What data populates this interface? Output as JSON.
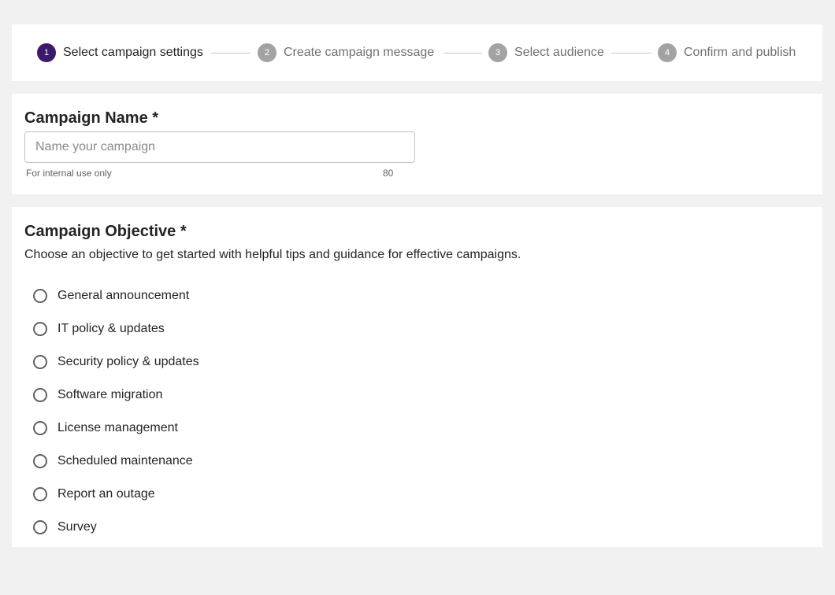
{
  "stepper": {
    "steps": [
      {
        "number": "1",
        "label": "Select campaign settings"
      },
      {
        "number": "2",
        "label": "Create campaign message"
      },
      {
        "number": "3",
        "label": "Select audience"
      },
      {
        "number": "4",
        "label": "Confirm and publish"
      }
    ],
    "active_step": 1
  },
  "campaign_name": {
    "title": "Campaign Name *",
    "placeholder": "Name your campaign",
    "value": "",
    "helper_text": "For internal use only",
    "char_limit": "80"
  },
  "campaign_objective": {
    "title": "Campaign Objective *",
    "description": "Choose an objective to get started with helpful tips and guidance for effective campaigns.",
    "options": [
      {
        "label": "General announcement"
      },
      {
        "label": "IT policy & updates"
      },
      {
        "label": "Security policy & updates"
      },
      {
        "label": "Software migration"
      },
      {
        "label": "License management"
      },
      {
        "label": "Scheduled maintenance"
      },
      {
        "label": "Report an outage"
      },
      {
        "label": "Survey"
      }
    ],
    "selected": null
  },
  "colors": {
    "active_step": "#3b1a6b",
    "inactive_step": "#a3a3a3",
    "page_background": "#f1f1f1"
  }
}
